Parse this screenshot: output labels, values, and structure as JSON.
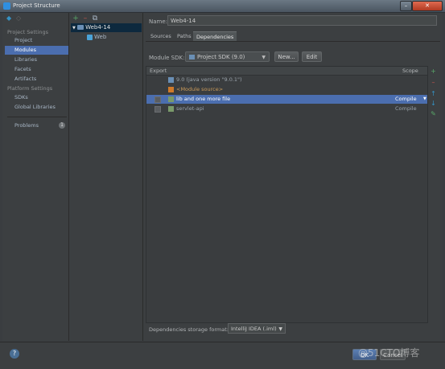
{
  "window": {
    "title": "Project Structure",
    "min_glyph": "–",
    "close_glyph": "✕"
  },
  "toolbar": {
    "back_glyph": "◆",
    "forward_glyph": "◇"
  },
  "sidebar": {
    "project_settings_header": "Project Settings",
    "project_settings": [
      "Project",
      "Modules",
      "Libraries",
      "Facets",
      "Artifacts"
    ],
    "platform_settings_header": "Platform Settings",
    "platform_settings": [
      "SDKs",
      "Global Libraries"
    ],
    "problems_label": "Problems",
    "problems_count": "1",
    "selected": "Modules"
  },
  "module_tree": {
    "add_glyph": "+",
    "remove_glyph": "–",
    "copy_glyph": "⧉",
    "expand_glyph": "▼",
    "root": "Web4-14",
    "child": "Web"
  },
  "module": {
    "name_label": "Name:",
    "name_value": "Web4-14",
    "tabs": [
      "Sources",
      "Paths",
      "Dependencies"
    ],
    "active_tab": "Dependencies",
    "sdk_label": "Module SDK:",
    "sdk_value": "Project SDK (9.0)",
    "new_button": "New...",
    "edit_button": "Edit",
    "deps_header_export": "Export",
    "deps_header_scope": "Scope",
    "dependencies": [
      {
        "label": "9.0 (java version \"9.0.1\")",
        "scope": "",
        "has_checkbox": false,
        "icon": "folder-icon"
      },
      {
        "label": "<Module source>",
        "scope": "",
        "has_checkbox": false,
        "icon": "module-source-icon"
      },
      {
        "label": "lib and one more file",
        "scope": "Compile",
        "has_checkbox": true,
        "icon": "library-icon"
      },
      {
        "label": "servlet-api",
        "scope": "Compile",
        "has_checkbox": true,
        "icon": "library-icon"
      }
    ],
    "selected_dependency_index": 2,
    "side_tools": [
      "+",
      "–",
      "↑",
      "↓",
      "✎"
    ],
    "storage_label": "Dependencies storage format:",
    "storage_value": "IntelliJ IDEA (.iml)",
    "dropdown_glyph": "▼"
  },
  "footer": {
    "help_glyph": "?",
    "ok_label": "OK",
    "cancel_label": "Cancel",
    "watermark": "@51CTO博客"
  },
  "colors": {
    "background": "#3c3f41",
    "selection": "#4b6eaf",
    "add_green": "#59a869",
    "remove_red": "#c75450",
    "arrow_blue": "#3592c4"
  }
}
